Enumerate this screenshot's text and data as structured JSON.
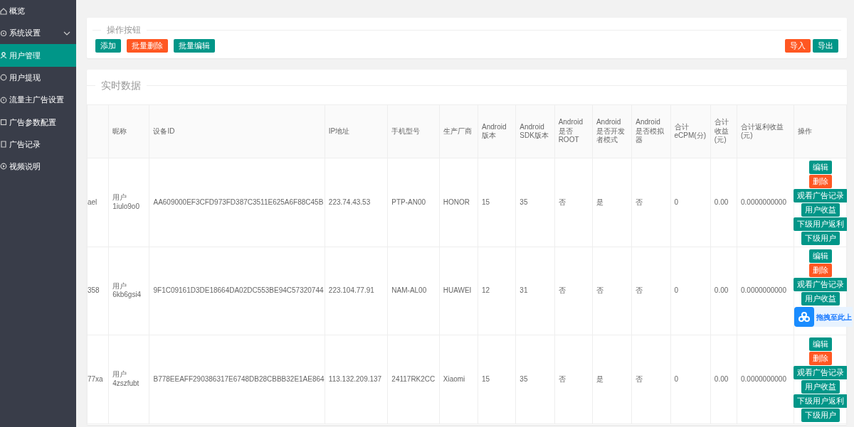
{
  "sidebar": {
    "items": [
      {
        "label": "概览",
        "kind": "link",
        "selected": false
      },
      {
        "label": "系统设置",
        "kind": "group",
        "selected": false
      },
      {
        "label": "用户管理",
        "kind": "link",
        "selected": true
      },
      {
        "label": "用户提现",
        "kind": "link",
        "selected": false
      },
      {
        "label": "流量主广告设置",
        "kind": "link",
        "selected": false
      },
      {
        "label": "广告参数配置",
        "kind": "link",
        "selected": false
      },
      {
        "label": "广告记录",
        "kind": "link",
        "selected": false
      },
      {
        "label": "视频说明",
        "kind": "link",
        "selected": false
      }
    ]
  },
  "toolbar": {
    "legend": "操作按钮",
    "left_buttons": [
      {
        "label": "添加",
        "kind": "normal"
      },
      {
        "label": "批量删除",
        "kind": "warm"
      },
      {
        "label": "批量编辑",
        "kind": "normal"
      }
    ],
    "right_buttons": [
      {
        "label": "导入",
        "kind": "warm"
      },
      {
        "label": "导出",
        "kind": "normal"
      }
    ]
  },
  "table": {
    "legend": "实时数据",
    "columns": [
      {
        "kind": "cut"
      },
      {
        "kind": "text",
        "label": "昵称"
      },
      {
        "kind": "text",
        "label": "设备ID"
      },
      {
        "kind": "text",
        "label": "IP地址"
      },
      {
        "kind": "text",
        "label": "手机型号"
      },
      {
        "kind": "text",
        "label": "生产厂商"
      },
      {
        "kind": "text",
        "label": "Android版本"
      },
      {
        "kind": "text",
        "label": "Android SDK版本"
      },
      {
        "kind": "text",
        "label": "Android是否ROOT"
      },
      {
        "kind": "text",
        "label": "Android是否开发者模式"
      },
      {
        "kind": "text",
        "label": "Android是否模拟器"
      },
      {
        "kind": "text",
        "label": "合计eCPM(分)"
      },
      {
        "kind": "text",
        "label": "合计收益(元)"
      },
      {
        "kind": "text",
        "label": "合计返利收益(元)"
      },
      {
        "kind": "text",
        "label": "操作"
      }
    ],
    "rows": [
      {
        "cells": [
          "ael",
          "用户1iulo9o0",
          "AA609000EF3CFD973FD387C3511E625A6F88C45B",
          "223.74.43.53",
          "PTP-AN00",
          "HONOR",
          "15",
          "35",
          "否",
          "是",
          "否",
          "0",
          "0.00",
          "0.0000000000"
        ],
        "actions": [
          {
            "label": "编辑",
            "kind": "normal"
          },
          {
            "label": "删除",
            "kind": "warm"
          },
          {
            "label": "观看广告记录",
            "kind": "normal"
          },
          {
            "label": "用户收益",
            "kind": "normal"
          },
          {
            "label": "下级用户返利",
            "kind": "normal"
          },
          {
            "label": "下级用户",
            "kind": "normal"
          }
        ]
      },
      {
        "cells": [
          "358",
          "用户6kb6gsi4",
          "9F1C09161D3DE18664DA02DC553BE94C57320744",
          "223.104.77.91",
          "NAM-AL00",
          "HUAWEI",
          "12",
          "31",
          "否",
          "否",
          "否",
          "0",
          "0.00",
          "0.0000000000"
        ],
        "actions": [
          {
            "label": "编辑",
            "kind": "normal"
          },
          {
            "label": "删除",
            "kind": "warm"
          },
          {
            "label": "观看广告记录",
            "kind": "normal"
          },
          {
            "label": "用户收益",
            "kind": "normal"
          }
        ]
      },
      {
        "cells": [
          "77xa",
          "用户4zszfubt",
          "B778EEAFF290386317E6748DB28CBBB32E1AE864",
          "113.132.209.137",
          "24117RK2CC",
          "Xiaomi",
          "15",
          "35",
          "否",
          "是",
          "否",
          "0",
          "0.00",
          "0.0000000000"
        ],
        "actions": [
          {
            "label": "编辑",
            "kind": "normal"
          },
          {
            "label": "删除",
            "kind": "warm"
          },
          {
            "label": "观看广告记录",
            "kind": "normal"
          },
          {
            "label": "用户收益",
            "kind": "normal"
          },
          {
            "label": "下级用户返利",
            "kind": "normal"
          },
          {
            "label": "下级用户",
            "kind": "normal"
          }
        ]
      }
    ]
  },
  "upload_widget": {
    "label": "拖拽至此上"
  }
}
